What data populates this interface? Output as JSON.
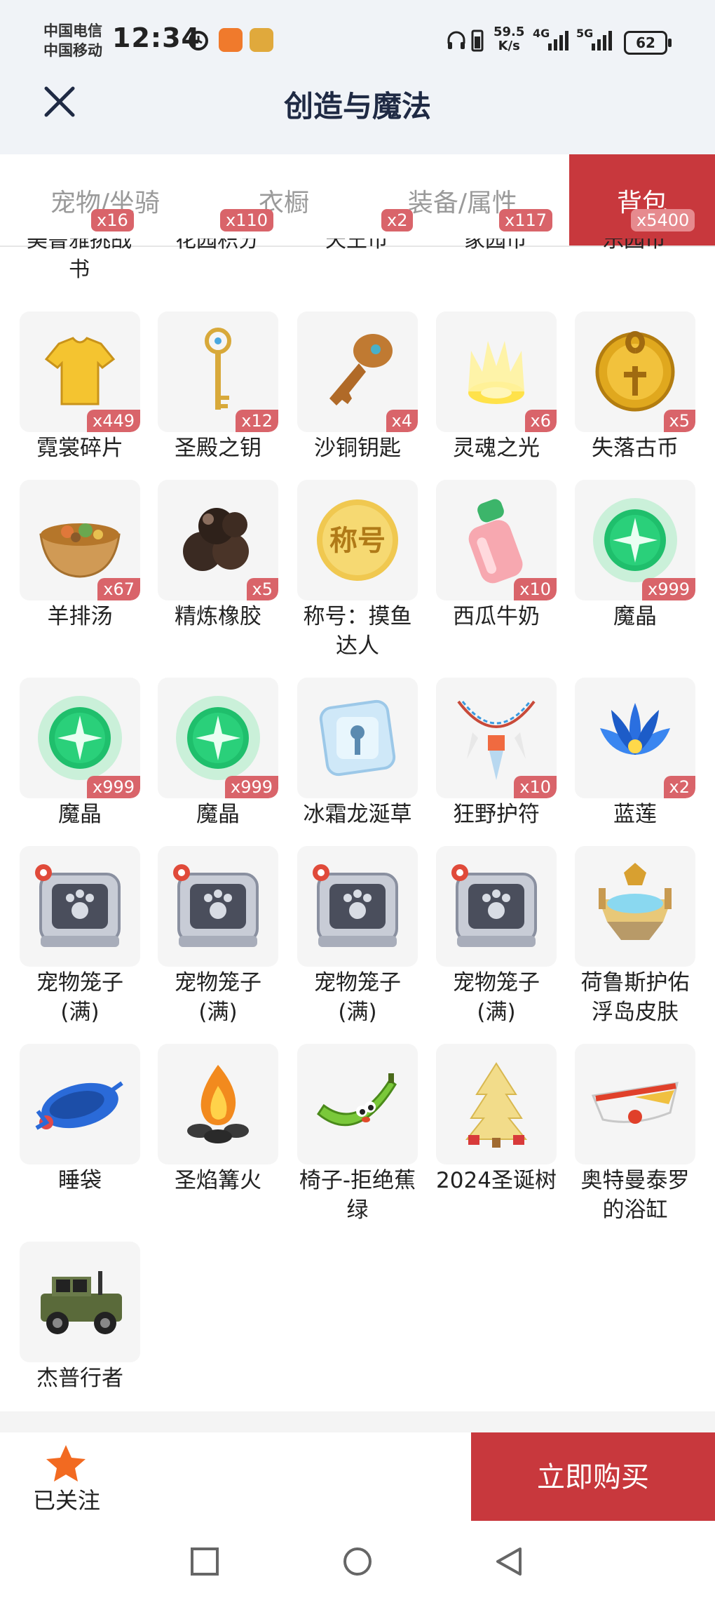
{
  "status_bar": {
    "carrier1": "中国电信",
    "carrier2": "中国移动",
    "time": "12:34",
    "net_speed_value": "59.5",
    "net_speed_unit": "K/s",
    "sig1": "4G",
    "sig2": "5G",
    "battery": "62"
  },
  "header": {
    "title": "创造与魔法"
  },
  "tabs": [
    {
      "label": "宠物/坐骑",
      "badge": "x16"
    },
    {
      "label": "衣橱",
      "badge": "x110"
    },
    {
      "label": "装备/属性",
      "badge": "x2"
    },
    {
      "label": "",
      "badge": "x117"
    },
    {
      "label": "背包",
      "badge": "x5400"
    }
  ],
  "partial_row": [
    "美鲁雅挑战书",
    "花园积分",
    "天王币",
    "家园币",
    "乐园币"
  ],
  "items": [
    {
      "name": "霓裳碎片",
      "qty": "x449",
      "icon": "gold-shirt-icon"
    },
    {
      "name": "圣殿之钥",
      "qty": "x12",
      "icon": "golden-key-icon"
    },
    {
      "name": "沙铜钥匙",
      "qty": "x4",
      "icon": "bronze-key-icon"
    },
    {
      "name": "灵魂之光",
      "qty": "x6",
      "icon": "soul-light-icon"
    },
    {
      "name": "失落古币",
      "qty": "x5",
      "icon": "ancient-coin-icon"
    },
    {
      "name": "羊排汤",
      "qty": "x67",
      "icon": "soup-bowl-icon"
    },
    {
      "name": "精炼橡胶",
      "qty": "x5",
      "icon": "rubber-icon"
    },
    {
      "name": "称号：摸鱼达人",
      "qty": "",
      "icon": "title-badge-icon",
      "badge_text": "称号"
    },
    {
      "name": "西瓜牛奶",
      "qty": "x10",
      "icon": "milk-bottle-icon"
    },
    {
      "name": "魔晶",
      "qty": "x999",
      "icon": "magic-crystal-icon"
    },
    {
      "name": "魔晶",
      "qty": "x999",
      "icon": "magic-crystal-icon"
    },
    {
      "name": "魔晶",
      "qty": "x999",
      "icon": "magic-crystal-icon"
    },
    {
      "name": "冰霜龙涎草",
      "qty": "",
      "icon": "ice-block-icon"
    },
    {
      "name": "狂野护符",
      "qty": "x10",
      "icon": "amulet-icon"
    },
    {
      "name": "蓝莲",
      "qty": "x2",
      "icon": "blue-lotus-icon"
    },
    {
      "name": "宠物笼子(满)",
      "qty": "",
      "icon": "pet-cage-icon"
    },
    {
      "name": "宠物笼子(满)",
      "qty": "",
      "icon": "pet-cage-icon"
    },
    {
      "name": "宠物笼子(满)",
      "qty": "",
      "icon": "pet-cage-icon"
    },
    {
      "name": "宠物笼子(满)",
      "qty": "",
      "icon": "pet-cage-icon"
    },
    {
      "name": "荷鲁斯护佑浮岛皮肤",
      "qty": "",
      "icon": "floating-island-icon"
    },
    {
      "name": "睡袋",
      "qty": "",
      "icon": "sleeping-bag-icon"
    },
    {
      "name": "圣焰篝火",
      "qty": "",
      "icon": "campfire-icon"
    },
    {
      "name": "椅子-拒绝蕉绿",
      "qty": "",
      "icon": "banana-chair-icon"
    },
    {
      "name": "2024圣诞树",
      "qty": "",
      "icon": "christmas-tree-icon"
    },
    {
      "name": "奥特曼泰罗的浴缸",
      "qty": "",
      "icon": "bathtub-icon"
    },
    {
      "name": "杰普行者",
      "qty": "",
      "icon": "jeep-icon"
    }
  ],
  "bottom": {
    "follow_label": "已关注",
    "buy_label": "立即购买"
  },
  "colors": {
    "accent": "#c8383d",
    "badge": "#d9646a",
    "star": "#f26a21"
  }
}
